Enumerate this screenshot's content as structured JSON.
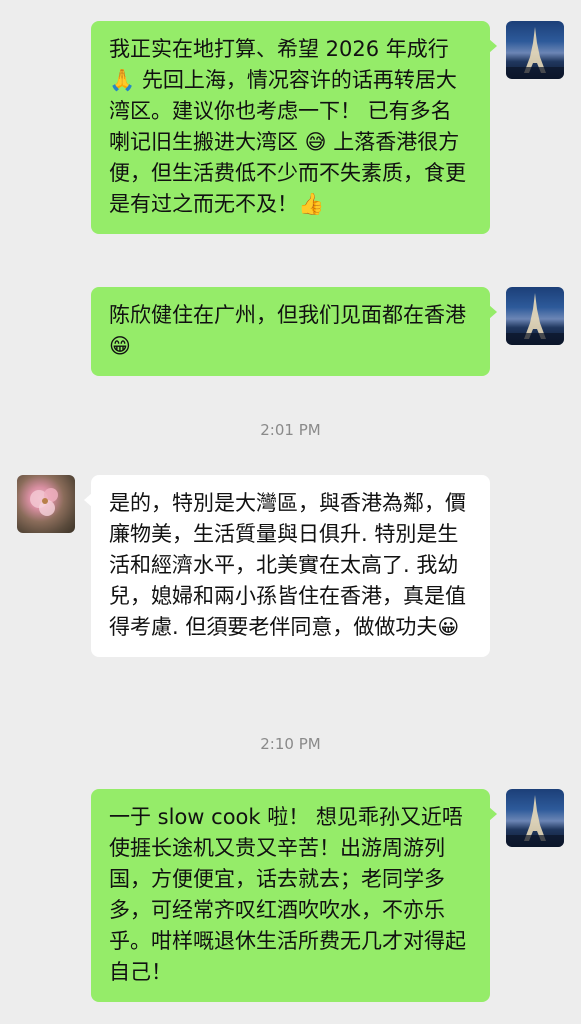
{
  "messages": [
    {
      "sender": "me",
      "text": "我正实在地打算、希望 2026 年成行 🙏 先回上海，情况容许的话再转居大湾区。建议你也考虑一下！ 已有多名喇记旧生搬进大湾区 😅 上落香港很方便，但生活费低不少而不失素质，食更是有过之而无不及！👍"
    },
    {
      "sender": "me",
      "text": "陈欣健住在广州，但我们见面都在香港 😁"
    },
    {
      "type": "timestamp",
      "text": "2:01 PM"
    },
    {
      "sender": "other",
      "text": "是的，特別是大灣區，與香港為鄰，價廉物美，生活質量與日俱升. 特別是生活和經濟水平，北美實在太高了. 我幼兒，媳婦和兩小孫皆住在香港，真是值得考慮. 但須要老伴同意，做做功夫😀"
    },
    {
      "type": "timestamp",
      "text": "2:10 PM"
    },
    {
      "sender": "me",
      "text": "一于 slow cook 啦！ 想见乖孙又近唔使捱长途机又贵又辛苦！出游周游列国，方便便宜，话去就去；老同学多多，可经常齐叹红酒吹吹水，不亦乐乎。咁样嘅退休生活所费无几才对得起自己！"
    }
  ],
  "avatars": {
    "me": "paris-eiffel-night-avatar",
    "other": "pink-flower-avatar"
  },
  "colors": {
    "background": "#ededed",
    "my_bubble": "#95ec69",
    "other_bubble": "#ffffff",
    "timestamp": "#8a8a8a"
  }
}
